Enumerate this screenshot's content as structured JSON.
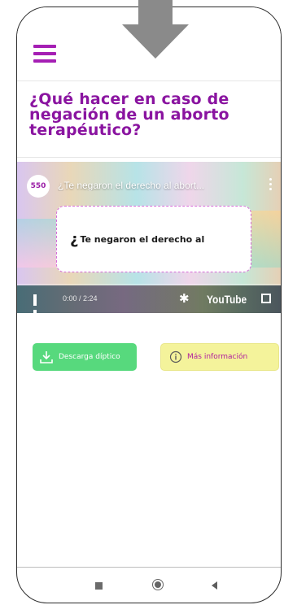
{
  "header": {
    "menu_icon": "hamburger-menu-icon"
  },
  "page": {
    "title": "¿Qué hacer en caso de negación de un aborto terapéutico?"
  },
  "video": {
    "channel_logo_text": "550",
    "title": "¿Te negaron el derecho al abort...",
    "card_text": "Te negaron el derecho al",
    "card_question_mark": "¿",
    "time": "0:00 / 2:24",
    "platform": "YouTube",
    "progress": 0.0
  },
  "actions": {
    "download_label": "Descarga díptico",
    "info_label": "Más información"
  },
  "colors": {
    "accent_purple": "#a51fb4",
    "title_purple": "#8a14a0",
    "download_green": "#57d97d",
    "info_yellow": "#f4f39b",
    "arrow_gray": "#8a8a8a"
  },
  "nav": {
    "recent_icon": "square-icon",
    "home_icon": "circle-icon",
    "back_icon": "triangle-back-icon"
  }
}
